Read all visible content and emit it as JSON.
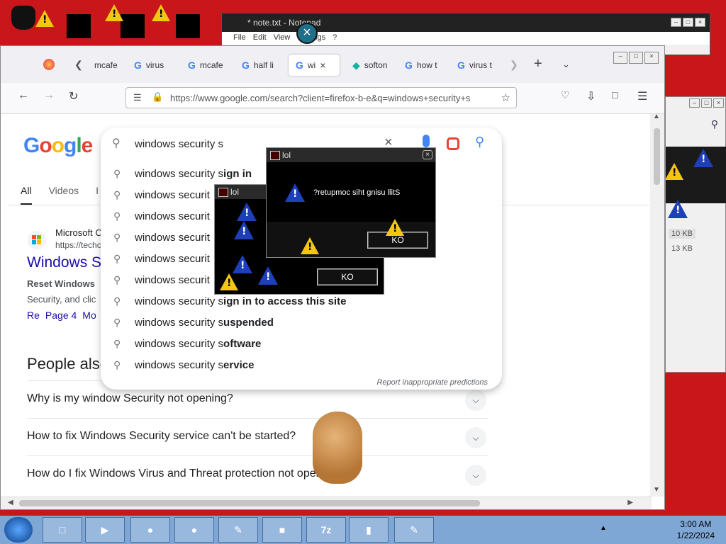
{
  "desktop": {
    "icons": [
      "desktop-icon-1",
      "desktop-icon-2",
      "desktop-icon-3",
      "desktop-icon-4"
    ]
  },
  "notepad": {
    "title": "* note.txt - Notepad",
    "menu": [
      "File",
      "Edit",
      "View",
      "Settings",
      "?"
    ]
  },
  "browser": {
    "tabs": [
      "mcafe",
      "virus",
      "mcafe",
      "half li",
      "wi",
      "softon",
      "how t",
      "virus t"
    ],
    "url": "https://www.google.com/search?client=firefox-b-e&q=windows+security+s",
    "search_query": "windows security s",
    "search_tabs": [
      "All",
      "Videos",
      "I"
    ],
    "result": {
      "site": "Microsoft C",
      "url": "https://techc",
      "title": "Windows S",
      "snippet_bold": "Reset Windows",
      "snippet": "Security, and clic",
      "links": [
        "Re",
        "Page 4",
        "Mo"
      ]
    },
    "paa_heading": "People also",
    "paa": [
      "Why is my window Security not opening?",
      "How to fix Windows Security service can't be started?",
      "How do I fix Windows Virus and Threat protection not oper"
    ]
  },
  "suggestions": {
    "items": [
      {
        "prefix": "windows security s",
        "bold": "ign in"
      },
      {
        "prefix": "windows securit",
        "bold": ""
      },
      {
        "prefix": "windows securit",
        "bold": ""
      },
      {
        "prefix": "windows securit",
        "bold": ""
      },
      {
        "prefix": "windows securit",
        "bold": ""
      },
      {
        "prefix": "windows securit",
        "bold": ""
      },
      {
        "prefix": "windows security s",
        "bold": "ign in to access this site"
      },
      {
        "prefix": "windows security s",
        "bold": "uspended"
      },
      {
        "prefix": "windows security s",
        "bold": "oftware"
      },
      {
        "prefix": "windows security s",
        "bold": "ervice"
      }
    ],
    "report": "Report inappropriate predictions"
  },
  "dialogs": [
    {
      "title": "lol",
      "message": "?retupmoc siht gnisu llitS",
      "button": "KO"
    },
    {
      "title": "lol",
      "message": "",
      "button": "KO"
    }
  ],
  "sidewin": {
    "sizes": [
      "10 KB",
      "13 KB"
    ]
  },
  "taskbar": {
    "time": "3:00 AM",
    "date": "1/22/2024"
  },
  "colors": {
    "desktop_bg": "#c8161a",
    "google_blue": "#4285f4",
    "link": "#1a0dab"
  }
}
